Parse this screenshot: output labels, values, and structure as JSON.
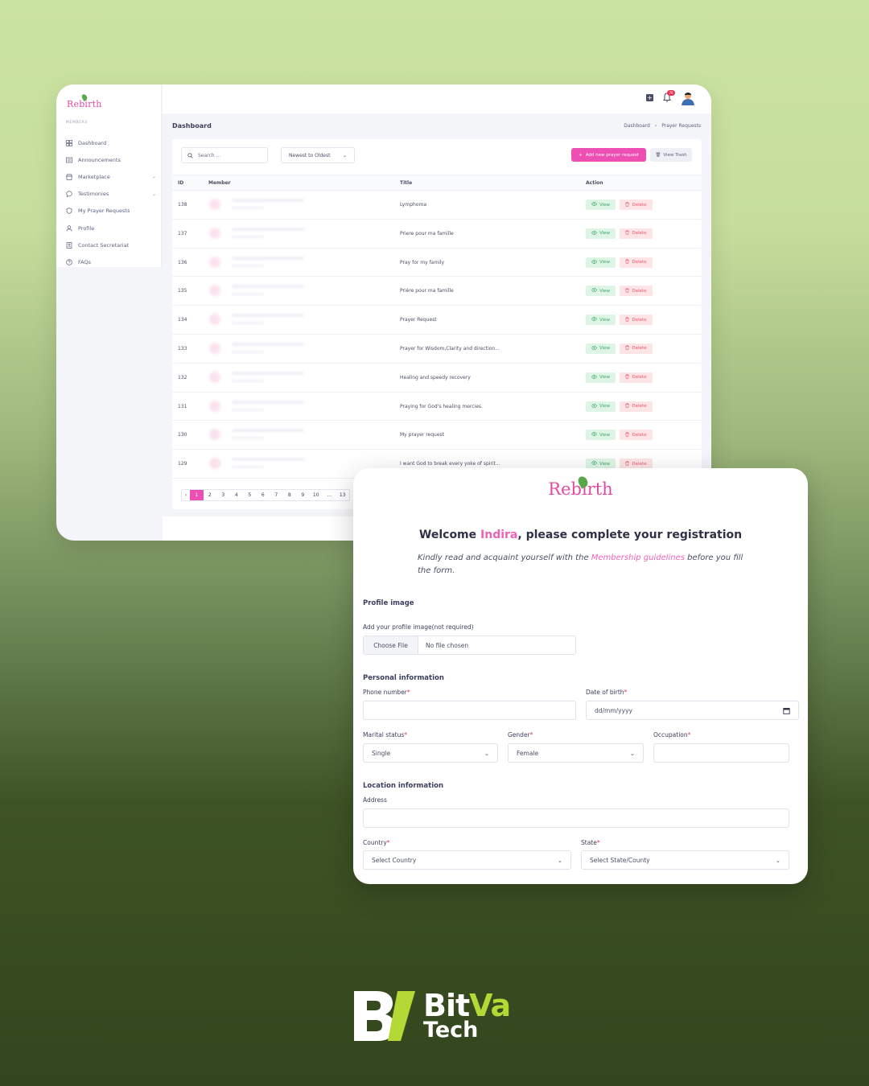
{
  "dashboard": {
    "logo": "Rebirth",
    "sidebar": {
      "section": "MEMBERS",
      "items": [
        {
          "label": "Dashboard",
          "icon": "grid-icon",
          "chevron": false
        },
        {
          "label": "Announcements",
          "icon": "newspaper-icon",
          "chevron": false
        },
        {
          "label": "Marketplace",
          "icon": "store-icon",
          "chevron": true
        },
        {
          "label": "Testimonies",
          "icon": "chat-bubble-icon",
          "chevron": true
        },
        {
          "label": "My Prayer Requests",
          "icon": "shield-icon",
          "chevron": false
        },
        {
          "label": "Profile",
          "icon": "user-icon",
          "chevron": false
        },
        {
          "label": "Contact Secretariat",
          "icon": "address-book-icon",
          "chevron": false
        },
        {
          "label": "FAQs",
          "icon": "question-icon",
          "chevron": false
        }
      ]
    },
    "topbar": {
      "notification_count": "76"
    },
    "page_title": "Dashboard",
    "breadcrumb": {
      "home": "Dashboard",
      "separator": "›",
      "current": "Prayer Requests"
    },
    "toolbar": {
      "search_placeholder": "Search ...",
      "sort_label": "Newest to Oldest",
      "add_label": "Add new prayer request",
      "trash_label": "View Trash"
    },
    "table": {
      "headers": {
        "id": "ID",
        "member": "Member",
        "title": "Title",
        "action": "Action"
      },
      "view_label": "View",
      "delete_label": "Delete",
      "rows": [
        {
          "id": "138",
          "title": "Lymphoma"
        },
        {
          "id": "137",
          "title": "Priere pour ma famille"
        },
        {
          "id": "136",
          "title": "Pray for my family"
        },
        {
          "id": "135",
          "title": "Prière pour ma famille"
        },
        {
          "id": "134",
          "title": "Prayer Request"
        },
        {
          "id": "133",
          "title": "Prayer for Wisdom,Clarity and direction..."
        },
        {
          "id": "132",
          "title": "Healing and speedy recovery"
        },
        {
          "id": "131",
          "title": "Praying for God's healing mercies."
        },
        {
          "id": "130",
          "title": "My prayer request"
        },
        {
          "id": "129",
          "title": "I want God to break every yoke of spirit..."
        }
      ]
    },
    "pagination": {
      "prev": "‹",
      "pages": [
        "1",
        "2",
        "3",
        "4",
        "5",
        "6",
        "7",
        "8",
        "9",
        "10",
        "...",
        "13"
      ],
      "active": "1"
    }
  },
  "registration": {
    "logo": "Rebirth",
    "welcome_prefix": "Welcome ",
    "welcome_name": "Indira",
    "welcome_suffix": ", please complete your registration",
    "intro_prefix": "Kindly read and acquaint yourself with the ",
    "intro_link": "Membership guidelines",
    "intro_suffix": " before you fill the form.",
    "profile_section": "Profile image",
    "profile_label": "Add your profile image(not required)",
    "file_button": "Choose File",
    "file_status": "No file chosen",
    "personal_section": "Personal information",
    "phone_label": "Phone number",
    "dob_label": "Date of birth",
    "dob_placeholder": "dd/mm/yyyy",
    "marital_label": "Marital status",
    "marital_value": "Single",
    "gender_label": "Gender",
    "gender_value": "Female",
    "occupation_label": "Occupation",
    "location_section": "Location information",
    "address_label": "Address",
    "country_label": "Country",
    "country_value": "Select Country",
    "state_label": "State",
    "state_value": "Select State/County",
    "required_mark": "*"
  },
  "brand": {
    "name_part1": "Bit",
    "name_part2": "Va",
    "name_line2": "Tech",
    "accent_color": "#b4d835"
  }
}
